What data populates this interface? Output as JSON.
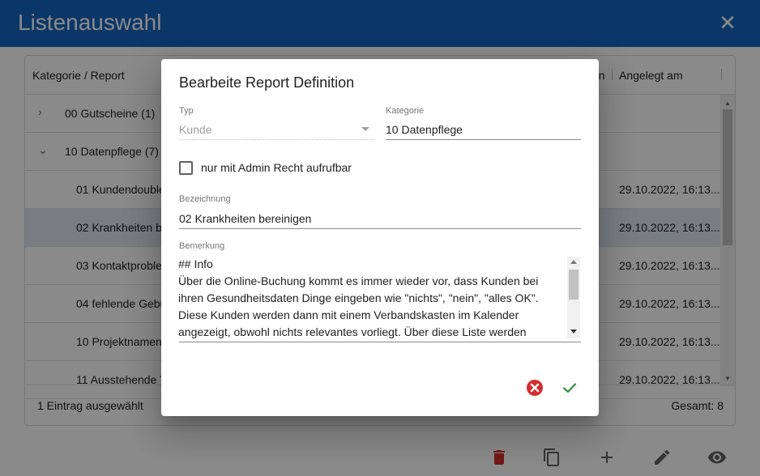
{
  "window": {
    "title": "Listenauswahl",
    "close_icon": "close-icon"
  },
  "table": {
    "headers": [
      "Kategorie / Report",
      "on",
      "Angelegt am"
    ],
    "rows": [
      {
        "label": "00 Gutscheine (1)",
        "type": "group",
        "expanded": false,
        "date": ""
      },
      {
        "label": "10 Datenpflege (7)",
        "type": "group",
        "expanded": true,
        "date": ""
      },
      {
        "label": "01 Kundendoublet",
        "type": "item",
        "date": "29.10.2022, 16:13..."
      },
      {
        "label": "02 Krankheiten be",
        "type": "item",
        "selected": true,
        "date": "29.10.2022, 16:13..."
      },
      {
        "label": "03 Kontaktproblem",
        "type": "item",
        "date": "29.10.2022, 16:13..."
      },
      {
        "label": "04 fehlende Gebur",
        "type": "item",
        "date": "29.10.2022, 16:13..."
      },
      {
        "label": "10 Projektnamen p",
        "type": "item",
        "date": "29.10.2022, 16:13..."
      },
      {
        "label": "11 Ausstehende Te",
        "type": "item",
        "date": "29.10.2022, 16:13..."
      }
    ],
    "footer_left": "1 Eintrag ausgewählt",
    "footer_right": "Gesamt: 8"
  },
  "toolbar": {
    "icons": [
      "trash-icon",
      "copy-icon",
      "plus-icon",
      "pencil-icon",
      "eye-icon"
    ],
    "colors": {
      "trash": "#d32f2f",
      "default": "#616161"
    }
  },
  "dialog": {
    "title": "Bearbeite Report Definition",
    "typ": {
      "label": "Typ",
      "value": "Kunde"
    },
    "kategorie": {
      "label": "Kategorie",
      "value": "10 Datenpflege"
    },
    "admin_checkbox": {
      "label": "nur mit Admin Recht aufrufbar",
      "checked": false
    },
    "bezeichnung": {
      "label": "Bezeichnung",
      "value": "02 Krankheiten bereinigen"
    },
    "bemerkung": {
      "label": "Bemerkung",
      "lines": [
        "## Info",
        "Über die Online-Buchung kommt es immer wieder vor, dass Kunden bei",
        "ihren Gesundheitsdaten Dinge eingeben wie \"nichts\", \"nein\", \"alles OK\".",
        "Diese Kunden werden dann mit einem Verbandskasten im Kalender",
        "angezeigt, obwohl nichts relevantes vorliegt. Über diese Liste werden"
      ]
    },
    "colors": {
      "cancel": "#d32f2f",
      "confirm": "#388e3c"
    }
  }
}
